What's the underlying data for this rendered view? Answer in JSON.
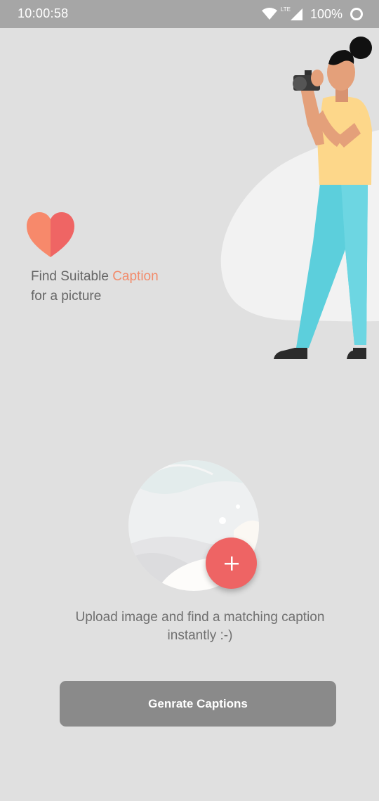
{
  "status_bar": {
    "time": "10:00:58",
    "network_label": "LTE",
    "battery": "100%"
  },
  "hero": {
    "line1_prefix": "Find Suitable ",
    "line1_accent": "Caption",
    "line2": "for a picture",
    "icon": "heart-icon",
    "illustration": "photographer-illustration"
  },
  "upload": {
    "add_icon": "plus-icon",
    "hint_line1": "Upload image and find a matching caption",
    "hint_line2": "instantly :-)"
  },
  "actions": {
    "generate_label": "Genrate Captions"
  },
  "colors": {
    "background": "#e0e0e0",
    "status_bar": "#a6a6a6",
    "accent": "#f28b6b",
    "fab": "#ee6464",
    "button": "#8a8a8a"
  }
}
